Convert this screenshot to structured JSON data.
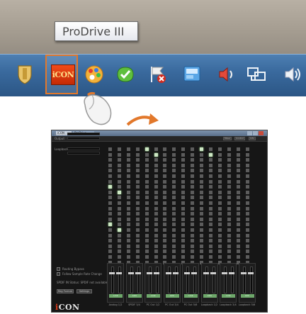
{
  "tooltip": {
    "text": "ProDrive III"
  },
  "taskbar": {
    "highlighted_app": {
      "name": "iCON",
      "label": "iCON"
    },
    "tray_icons": [
      "shield-icon",
      "icon-app-icon",
      "palette-icon",
      "update-check-icon",
      "action-center-flag-icon",
      "network-monitor-icon",
      "volume-icon",
      "network-icon",
      "volume-icon"
    ]
  },
  "app": {
    "title_tabs": [
      "iCON",
      "ProDrive"
    ],
    "toolbar": {
      "left": "Output",
      "mid": "48",
      "buttons": [
        "Mixer",
        "Control",
        "Info"
      ]
    },
    "inputs": [
      "Analog",
      "SPDIF",
      "PC In",
      "PC In",
      "PC In",
      "PC In",
      "Loopback",
      "Loopback",
      "Loopback"
    ],
    "options": [
      "Routing Bypass",
      "Follow Sample Rate Change",
      "SPDIF IN Status: SPDIF not available"
    ],
    "buttons": [
      "Reg Format",
      "Settings"
    ],
    "strips": [
      "Analog 1/2",
      "SPDIF 3/4",
      "PC Out 1/2",
      "PC Out 3/4",
      "PC Out 5/6",
      "Loopback 1/2",
      "Loopback 3/4",
      "Loopback 5/6"
    ],
    "strip_button": "Link",
    "brand": {
      "prefix": "i",
      "name": "CON"
    }
  },
  "colors": {
    "accent": "#e2782b",
    "active_cell": "#cde8c4",
    "taskbar": "#3a6a9e"
  },
  "matrix": {
    "rows": 22,
    "cols": 16,
    "active": [
      [
        0,
        4
      ],
      [
        0,
        10
      ],
      [
        1,
        5
      ],
      [
        1,
        11
      ],
      [
        7,
        0
      ],
      [
        8,
        1
      ],
      [
        14,
        0
      ],
      [
        15,
        1
      ]
    ]
  }
}
